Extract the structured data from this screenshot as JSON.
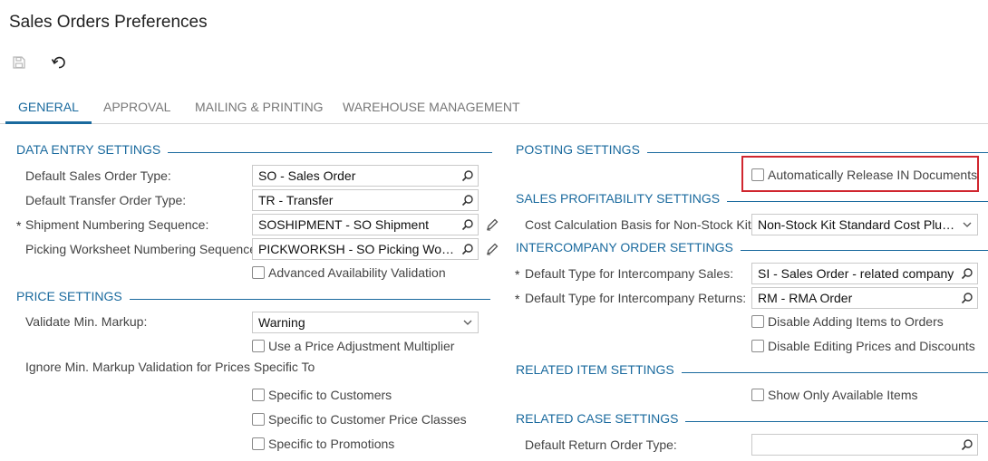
{
  "page": {
    "title": "Sales Orders Preferences"
  },
  "toolbar": {
    "save_icon": "save-icon",
    "undo_icon": "undo-icon"
  },
  "tabs": [
    {
      "label": "GENERAL",
      "active": true
    },
    {
      "label": "APPROVAL",
      "active": false
    },
    {
      "label": "MAILING & PRINTING",
      "active": false
    },
    {
      "label": "WAREHOUSE MANAGEMENT",
      "active": false
    }
  ],
  "left": {
    "data_entry": {
      "header": "DATA ENTRY SETTINGS",
      "default_sales_order_type": {
        "label": "Default Sales Order Type:",
        "value": "SO - Sales Order"
      },
      "default_transfer_order_type": {
        "label": "Default Transfer Order Type:",
        "value": "TR - Transfer"
      },
      "shipment_numbering_sequence": {
        "label": "Shipment Numbering Sequence:",
        "value": "SOSHIPMENT - SO Shipment",
        "required": "*"
      },
      "picking_worksheet_numbering": {
        "label": "Picking Worksheet Numbering Sequence:",
        "value": "PICKWORKSH - SO Picking Workshe"
      },
      "advanced_availability": {
        "label": "Advanced Availability Validation",
        "checked": false
      }
    },
    "price": {
      "header": "PRICE SETTINGS",
      "validate_min_markup": {
        "label": "Validate Min. Markup:",
        "value": "Warning"
      },
      "use_price_adjustment": {
        "label": "Use a Price Adjustment Multiplier",
        "checked": false
      },
      "ignore_label": "Ignore Min. Markup Validation for Prices Specific To",
      "specific_customers": {
        "label": "Specific to Customers",
        "checked": false
      },
      "specific_price_classes": {
        "label": "Specific to Customer Price Classes",
        "checked": false
      },
      "specific_promotions": {
        "label": "Specific to Promotions",
        "checked": false
      }
    }
  },
  "right": {
    "posting": {
      "header": "POSTING SETTINGS",
      "auto_release": {
        "label": "Automatically Release IN Documents",
        "checked": false
      }
    },
    "profitability": {
      "header": "SALES PROFITABILITY SETTINGS",
      "cost_calc": {
        "label": "Cost Calculation Basis for Non-Stock Kits:",
        "value": "Non-Stock Kit Standard Cost Plus St..."
      }
    },
    "intercompany": {
      "header": "INTERCOMPANY ORDER SETTINGS",
      "default_sales": {
        "label": "Default Type for Intercompany Sales:",
        "value": "SI - Sales Order - related company",
        "required": "*"
      },
      "default_returns": {
        "label": "Default Type for Intercompany Returns:",
        "value": "RM - RMA Order",
        "required": "*"
      },
      "disable_adding": {
        "label": "Disable Adding Items to Orders",
        "checked": false
      },
      "disable_editing": {
        "label": "Disable Editing Prices and Discounts",
        "checked": false
      }
    },
    "related_item": {
      "header": "RELATED ITEM SETTINGS",
      "show_only_available": {
        "label": "Show Only Available Items",
        "checked": false
      }
    },
    "related_case": {
      "header": "RELATED CASE SETTINGS",
      "default_return_order_type": {
        "label": "Default Return Order Type:",
        "value": ""
      }
    }
  },
  "colors": {
    "accent": "#1a6a9e",
    "highlight": "#d0262f"
  }
}
